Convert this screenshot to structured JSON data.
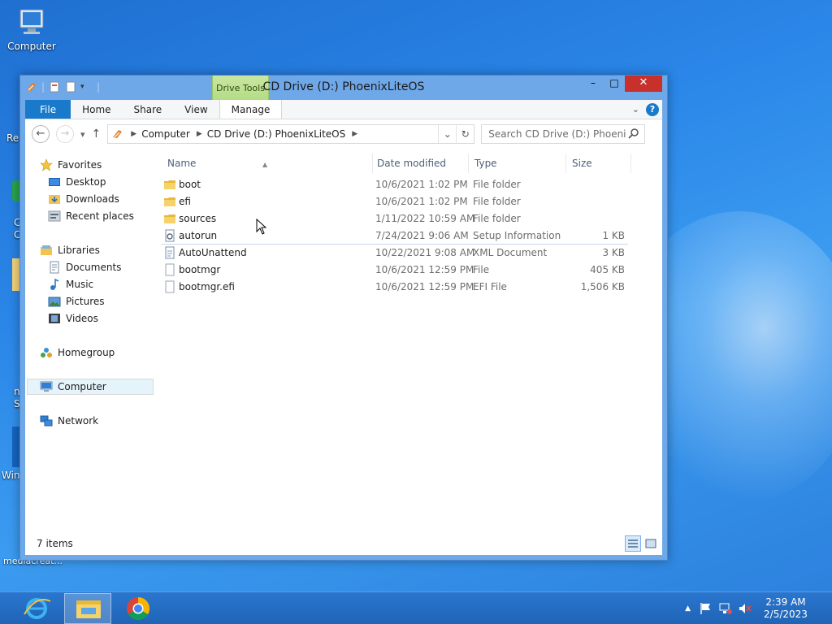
{
  "desktop": {
    "icons": [
      {
        "label": "Computer"
      }
    ],
    "edge_labels": [
      "Re",
      "C",
      "C",
      "n",
      "S",
      "Win",
      "mediacreat..."
    ]
  },
  "window": {
    "title": "CD Drive (D:) PhoenixLiteOS",
    "contextual_tab": "Drive Tools",
    "controls": {
      "minimize": "–",
      "maximize": "□",
      "close": "✕"
    },
    "ribbon_tabs": [
      "File",
      "Home",
      "Share",
      "View",
      "Manage"
    ]
  },
  "address_bar": {
    "breadcrumbs": [
      "Computer",
      "CD Drive (D:) PhoenixLiteOS"
    ],
    "search_placeholder": "Search CD Drive (D:) PhoenixL..."
  },
  "nav_pane": {
    "favorites": {
      "label": "Favorites",
      "items": [
        "Desktop",
        "Downloads",
        "Recent places"
      ]
    },
    "libraries": {
      "label": "Libraries",
      "items": [
        "Documents",
        "Music",
        "Pictures",
        "Videos"
      ]
    },
    "homegroup": "Homegroup",
    "computer": "Computer",
    "network": "Network",
    "selected": "Computer"
  },
  "file_list": {
    "columns": [
      "Name",
      "Date modified",
      "Type",
      "Size"
    ],
    "rows": [
      {
        "name": "boot",
        "date": "10/6/2021 1:02 PM",
        "type": "File folder",
        "size": "",
        "icon": "folder-icon"
      },
      {
        "name": "efi",
        "date": "10/6/2021 1:02 PM",
        "type": "File folder",
        "size": "",
        "icon": "folder-icon"
      },
      {
        "name": "sources",
        "date": "1/11/2022 10:59 AM",
        "type": "File folder",
        "size": "",
        "icon": "folder-icon"
      },
      {
        "name": "autorun",
        "date": "7/24/2021 9:06 AM",
        "type": "Setup Information",
        "size": "1 KB",
        "icon": "settings-file-icon"
      },
      {
        "name": "AutoUnattend",
        "date": "10/22/2021 9:08 AM",
        "type": "XML Document",
        "size": "3 KB",
        "icon": "xml-file-icon"
      },
      {
        "name": "bootmgr",
        "date": "10/6/2021 12:59 PM",
        "type": "File",
        "size": "405 KB",
        "icon": "file-icon"
      },
      {
        "name": "bootmgr.efi",
        "date": "10/6/2021 12:59 PM",
        "type": "EFI File",
        "size": "1,506 KB",
        "icon": "file-icon"
      }
    ]
  },
  "status_bar": {
    "item_count": "7 items"
  },
  "taskbar": {
    "apps": [
      "internet-explorer-icon",
      "file-explorer-icon",
      "chrome-icon"
    ],
    "clock": {
      "time": "2:39 AM",
      "date": "2/5/2023"
    }
  },
  "colors": {
    "accent": "#1979ca",
    "close": "#c7302b",
    "drive_tools": "#c9e7a3"
  }
}
